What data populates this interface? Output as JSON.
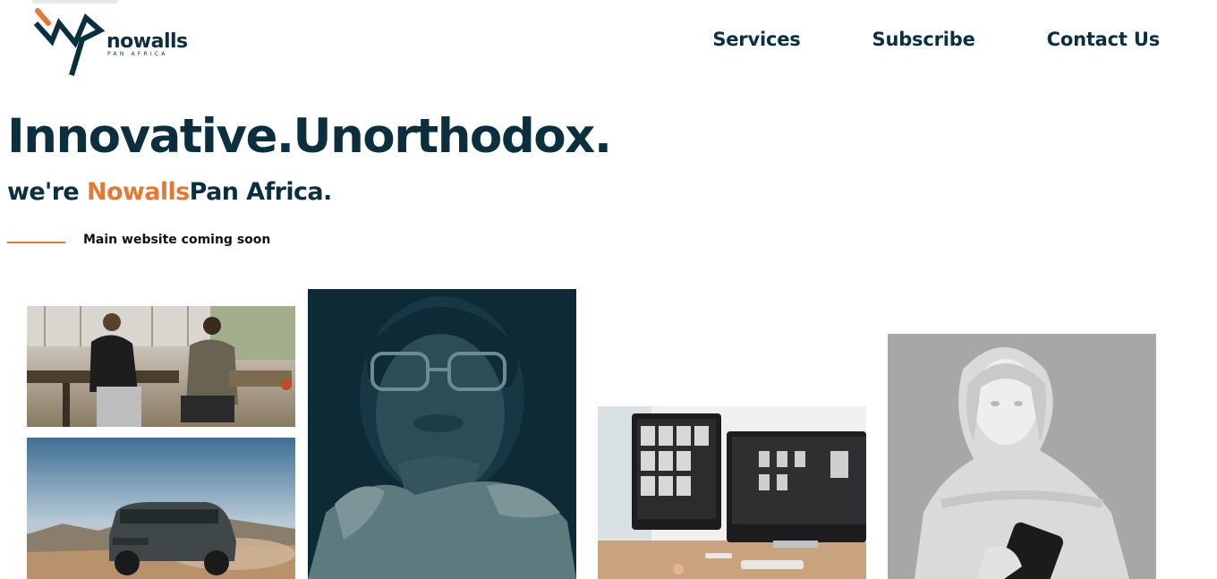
{
  "brand": {
    "name": "nowalls",
    "subtitle": "PAN AFRICA",
    "colors": {
      "navy": "#0b2f3e",
      "orange": "#e07a35"
    }
  },
  "nav": {
    "items": [
      {
        "label": "Services"
      },
      {
        "label": "Subscribe"
      },
      {
        "label": "Contact Us"
      }
    ]
  },
  "hero": {
    "headline": "Innovative.Unorthodox.",
    "sub_prefix": "we're ",
    "sub_accent": "Nowalls",
    "sub_suffix": "Pan Africa.",
    "tagline": "Main website coming soon"
  },
  "gallery": {
    "images": [
      {
        "name": "meeting-photo"
      },
      {
        "name": "suv-desert-photo"
      },
      {
        "name": "portrait-photo"
      },
      {
        "name": "desk-monitors-photo"
      },
      {
        "name": "statue-phone-photo"
      }
    ]
  }
}
